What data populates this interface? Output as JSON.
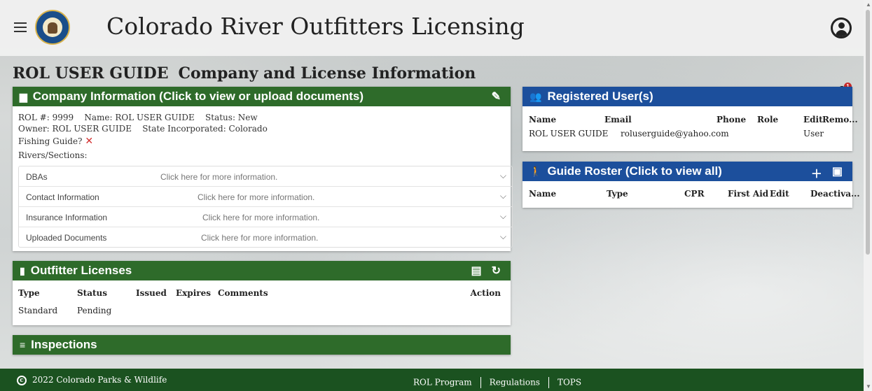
{
  "header": {
    "app_title": "Colorado River Outfitters Licensing",
    "logo_text": "COLORADO PARKS & WILDLIFE",
    "icons": [
      "menu-icon",
      "account-icon"
    ]
  },
  "page": {
    "title_left": "ROL USER GUIDE",
    "title_right": "Company and License Information",
    "notification_count": "1"
  },
  "company": {
    "header": "Company Information (Click to view or upload documents)",
    "rol_line": "ROL #: 9999    Name: ROL USER GUIDE    Status: New",
    "owner_line": "Owner: ROL USER GUIDE    State Incorporated: Colorado",
    "fishing_label": "Fishing Guide?",
    "fishing_value": "✕",
    "rivers_label": "Rivers/Sections:",
    "accordion": [
      {
        "label": "DBAs",
        "hint": "Click here for more information."
      },
      {
        "label": "Contact Information",
        "hint": "Click here for more information."
      },
      {
        "label": "Insurance Information",
        "hint": "Click here for more information."
      },
      {
        "label": "Uploaded Documents",
        "hint": "Click here for more information."
      }
    ]
  },
  "licenses": {
    "header": "Outfitter Licenses",
    "columns": [
      "Type",
      "Status",
      "Issued",
      "Expires",
      "Comments",
      "Action"
    ],
    "rows": [
      {
        "type": "Standard",
        "status": "Pending"
      }
    ]
  },
  "inspections": {
    "header": "Inspections"
  },
  "registered_users": {
    "header": "Registered User(s)",
    "columns": [
      "Name",
      "Email",
      "Phone",
      "Role",
      "Edit",
      "Remo..."
    ],
    "rows": [
      {
        "name": "ROL USER GUIDE",
        "email": "roluserguide@yahoo.com",
        "role": "User"
      }
    ]
  },
  "guide_roster": {
    "header": "Guide Roster (Click to view all)",
    "columns": [
      "Name",
      "Type",
      "CPR",
      "First Aid",
      "Edit",
      "Deactiva..."
    ]
  },
  "footer": {
    "copyright": "2022 Colorado Parks & Wildlife",
    "links": [
      "ROL Program",
      "Regulations",
      "TOPS"
    ]
  },
  "colors": {
    "green_header": "#2e6b2a",
    "blue_header": "#1c4f9c",
    "footer": "#1b5220"
  }
}
